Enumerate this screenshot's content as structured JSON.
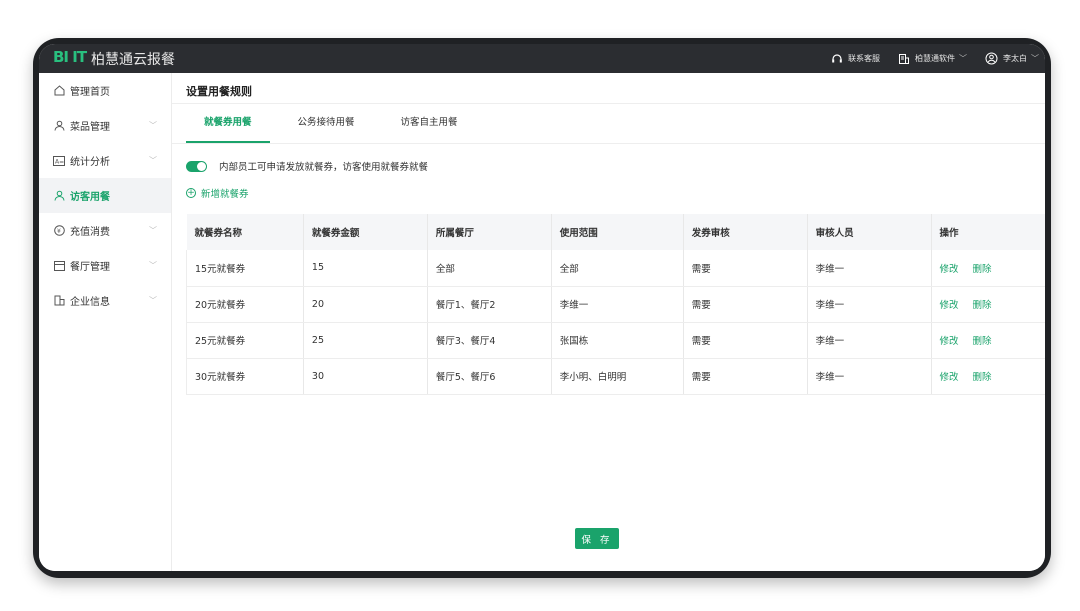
{
  "app": {
    "logo_mark": "BI IT",
    "name": "柏慧通云报餐"
  },
  "topbar": {
    "support_label": "联系客服",
    "company_label": "柏慧通软件",
    "user_label": "李太白"
  },
  "sidebar": {
    "items": [
      {
        "label": "管理首页",
        "icon": "home-icon"
      },
      {
        "label": "菜品管理",
        "icon": "user-icon"
      },
      {
        "label": "统计分析",
        "icon": "chart-icon"
      },
      {
        "label": "访客用餐",
        "icon": "user-icon"
      },
      {
        "label": "充值消费",
        "icon": "coin-icon"
      },
      {
        "label": "餐厅管理",
        "icon": "wallet-icon"
      },
      {
        "label": "企业信息",
        "icon": "building-icon"
      }
    ]
  },
  "main": {
    "page_title": "设置用餐规则",
    "tabs": [
      {
        "label": "就餐券用餐"
      },
      {
        "label": "公务接待用餐"
      },
      {
        "label": "访客自主用餐"
      }
    ],
    "toggle_label": "内部员工可申请发放就餐券，访客使用就餐券就餐",
    "add_label": "新增就餐券",
    "table": {
      "headers": [
        "就餐券名称",
        "就餐券金额",
        "所属餐厅",
        "使用范围",
        "发券审核",
        "审核人员",
        "操作"
      ],
      "rows": [
        [
          "15元就餐券",
          "15",
          "全部",
          "全部",
          "需要",
          "李维一"
        ],
        [
          "20元就餐券",
          "20",
          "餐厅1、餐厅2",
          "李维一",
          "需要",
          "李维一"
        ],
        [
          "25元就餐券",
          "25",
          "餐厅3、餐厅4",
          "张国栋",
          "需要",
          "李维一"
        ],
        [
          "30元就餐券",
          "30",
          "餐厅5、餐厅6",
          "李小明、白明明",
          "需要",
          "李维一"
        ]
      ],
      "edit_label": "修改",
      "delete_label": "删除"
    },
    "save_label": "保 存"
  },
  "colors": {
    "accent": "#1aa36b",
    "topbar": "#2b2d31",
    "device": "#1f2124"
  }
}
